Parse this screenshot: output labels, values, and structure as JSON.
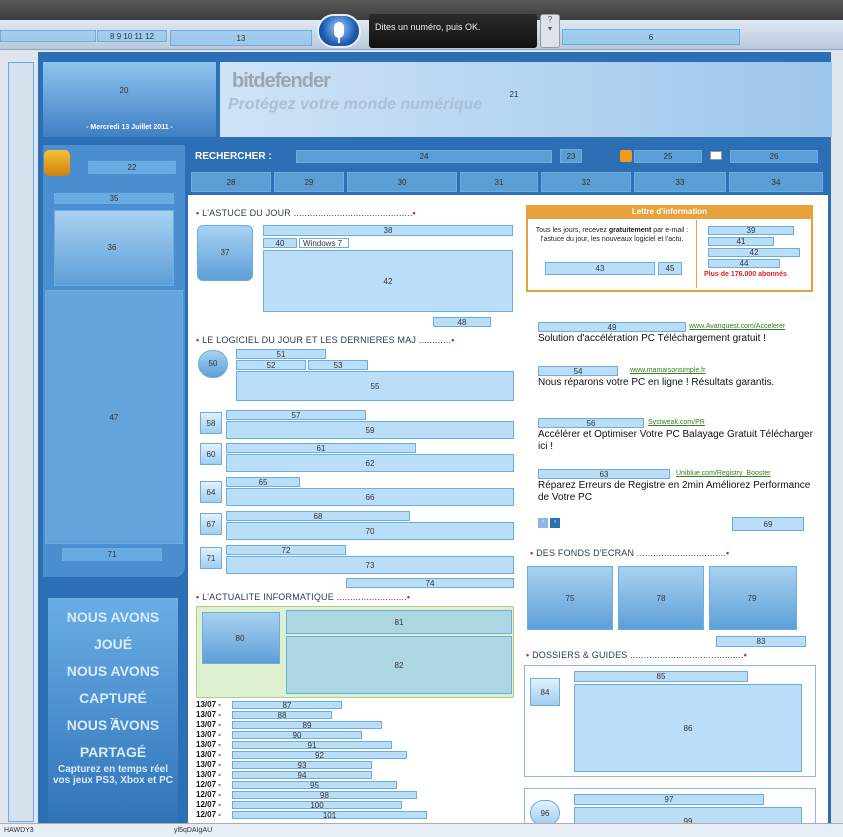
{
  "chrome": {
    "left_field_values": [
      "8",
      "9",
      "10",
      "11",
      "12"
    ],
    "field_13": "13",
    "speech_prompt": "Dites un numéro, puis OK.",
    "field_6": "6"
  },
  "header": {
    "logo_number": "20",
    "date": "- Mercredi 13 Juillet 2011 -",
    "banner_number": "21",
    "banner_brand": "bitdefender",
    "banner_tagline": "Protégez votre monde numérique"
  },
  "nav": {
    "search_label": "RECHERCHER :",
    "search_number": "24",
    "go_number": "23",
    "rss_number": "25",
    "mail_number": "26",
    "rss_link_number": "22",
    "tabs": [
      "28",
      "29",
      "30",
      "31",
      "32",
      "33",
      "34"
    ]
  },
  "left": {
    "box_number": "35",
    "image_number": "36",
    "text_number": "47",
    "link_number": "71",
    "promo_big": [
      "NOUS AVONS",
      "JOUÉ",
      "NOUS AVONS",
      "CAPTURÉ",
      "NOUS AVONS",
      "PARTAGÉ"
    ],
    "promo_small": "Capturez en temps réel vos jeux PS3, Xbox et PC",
    "promo_number": "76"
  },
  "astuce": {
    "heading": "L'ASTUCE DU JOUR",
    "icon_number": "37",
    "title_number": "38",
    "tag_number": "40",
    "tag_text": "Windows 7",
    "body_number": "42",
    "more_number": "48"
  },
  "logiciel": {
    "heading": "LE LOGICIEL DU JOUR ET LES DERNIERES MAJ",
    "items": [
      {
        "icon": "50",
        "a": "51",
        "b": "52",
        "c": "53",
        "desc": "55"
      },
      {
        "icon": "58",
        "a": "57",
        "desc": "59"
      },
      {
        "icon": "60",
        "a": "61",
        "desc": "62"
      },
      {
        "icon": "64",
        "a": "65",
        "desc": "66"
      },
      {
        "icon": "67",
        "a": "68",
        "desc": "70"
      },
      {
        "icon": "71",
        "a": "72",
        "desc": "73"
      }
    ],
    "more_number": "74"
  },
  "actualite": {
    "heading": "L'ACTUALITE INFORMATIQUE",
    "image_number": "80",
    "title_number": "81",
    "body_number": "82",
    "rows": [
      {
        "date": "13/07 -",
        "n": "87"
      },
      {
        "date": "13/07 -",
        "n": "88"
      },
      {
        "date": "13/07 -",
        "n": "89"
      },
      {
        "date": "13/07 -",
        "n": "90"
      },
      {
        "date": "13/07 -",
        "n": "91"
      },
      {
        "date": "13/07 -",
        "n": "92"
      },
      {
        "date": "13/07 -",
        "n": "93"
      },
      {
        "date": "13/07 -",
        "n": "94"
      },
      {
        "date": "12/07 -",
        "n": "95"
      },
      {
        "date": "12/07 -",
        "n": "98"
      },
      {
        "date": "12/07 -",
        "n": "100"
      },
      {
        "date": "12/07 -",
        "n": "101"
      }
    ]
  },
  "newsletter": {
    "heading": "Lettre d'information",
    "text_before": "Tous les jours, recevez ",
    "text_bold": "gratuitement",
    "text_after": " par e-mail : l'astuce du jour, les nouveaux logiciel et l'actu.",
    "input_number": "43",
    "ok_number": "45",
    "options": [
      "39",
      "41",
      "42",
      "44"
    ],
    "plus": "Plus de 176.000 abonnés"
  },
  "ads": [
    {
      "n": "49",
      "url": "www.Avanquest.com/Accelerer",
      "title": "Solution d'accélération PC Téléchargement gratuit !"
    },
    {
      "n": "54",
      "url": "www.mamaisonsimple.fr",
      "title": "Nous réparons votre PC en ligne ! Résultats garantis."
    },
    {
      "n": "56",
      "url": "Systweak.com/PR",
      "title": "Accélérer et Optimiser Votre PC Balayage Gratuit Télécharger ici !"
    },
    {
      "n": "63",
      "url": "Uniblue.com/Registry_Booster",
      "title": "Réparez Erreurs de Registre en 2min Améliorez Performance de Votre PC"
    }
  ],
  "ads_more": "69",
  "fonds": {
    "heading": "DES FONDS D'ECRAN",
    "thumbs": [
      "75",
      "78",
      "79"
    ],
    "more_number": "83"
  },
  "dossiers": {
    "heading": "DOSSIERS & GUIDES",
    "items": [
      {
        "icon": "84",
        "title": "85",
        "body": "86"
      },
      {
        "icon": "96",
        "title": "97",
        "body": "99"
      }
    ]
  },
  "status": {
    "left": "HAWDY3",
    "mid": "yl5qDAIgAU"
  }
}
